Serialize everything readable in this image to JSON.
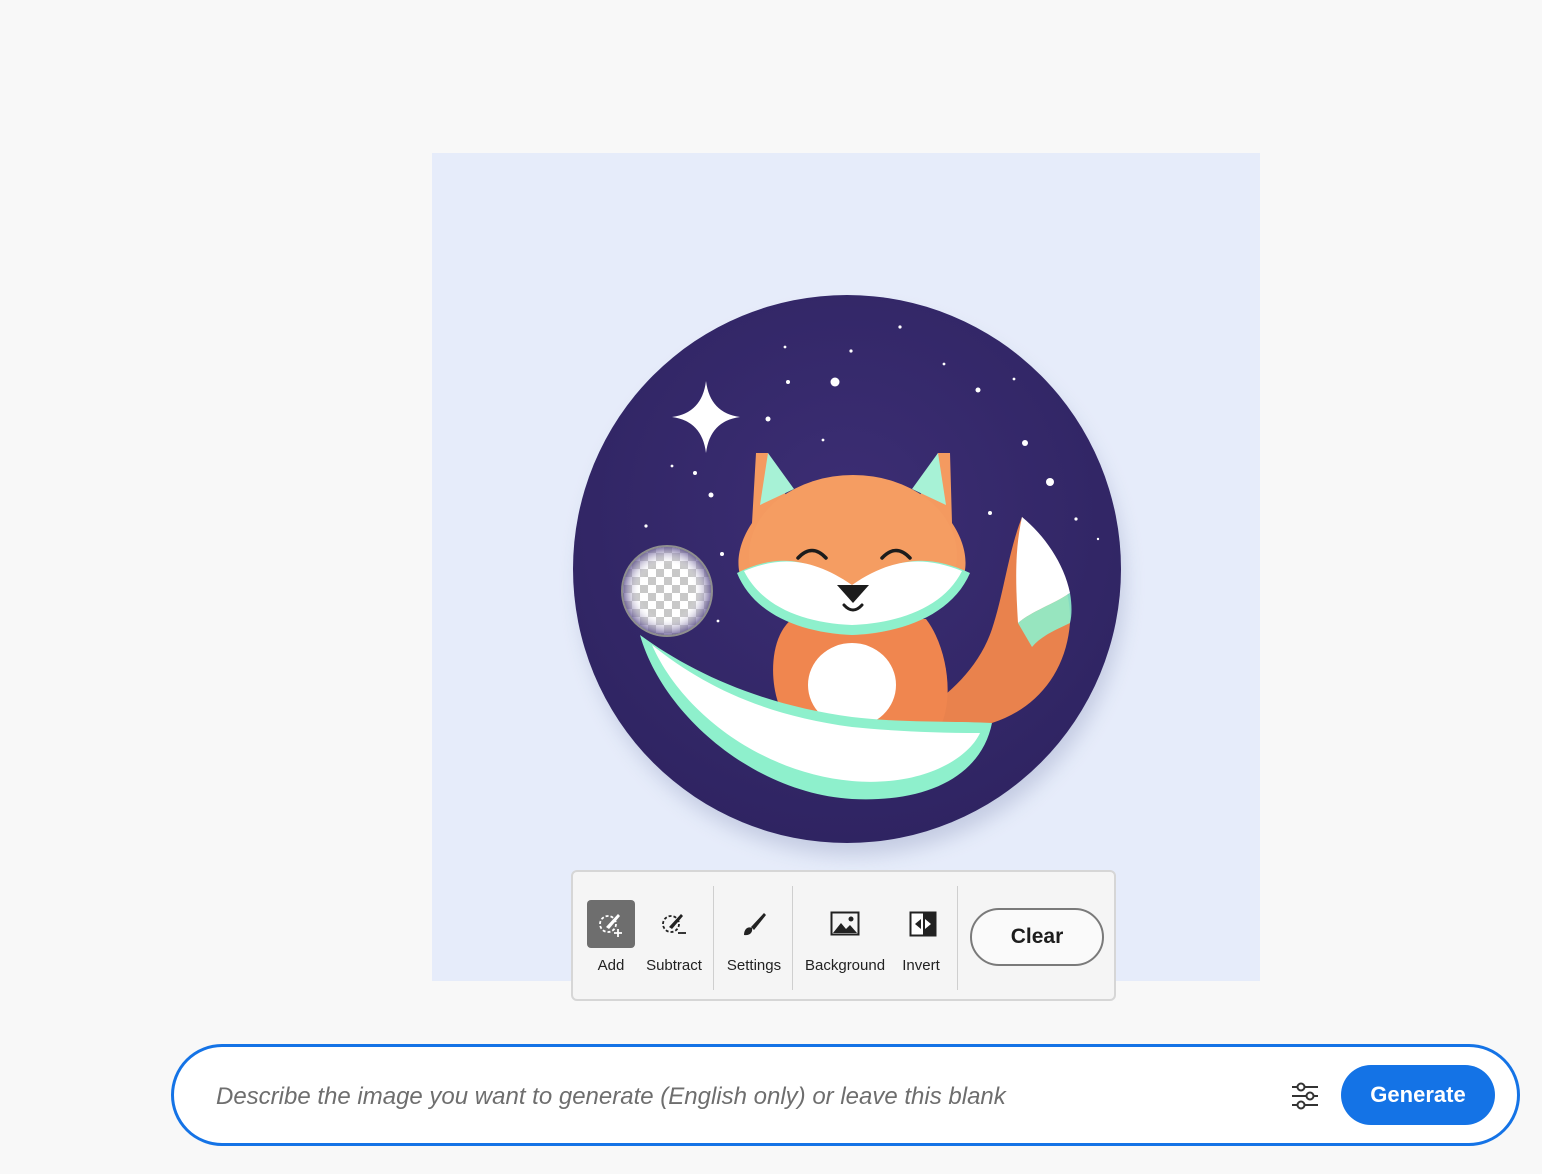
{
  "toolbar": {
    "add_label": "Add",
    "subtract_label": "Subtract",
    "settings_label": "Settings",
    "background_label": "Background",
    "invert_label": "Invert",
    "clear_label": "Clear"
  },
  "prompt": {
    "placeholder": "Describe the image you want to generate (English only) or leave this blank",
    "generate_label": "Generate"
  },
  "icons": {
    "add": "brush-add-icon",
    "subtract": "brush-subtract-icon",
    "settings": "brush-icon",
    "background": "image-icon",
    "invert": "invert-icon",
    "prompt_settings": "sliders-icon"
  },
  "colors": {
    "accent": "#1473e6",
    "canvas_bg": "#e6ecfa",
    "night_sky": "#352868",
    "fox_orange": "#f08a55",
    "mint": "#8ef0cc"
  }
}
